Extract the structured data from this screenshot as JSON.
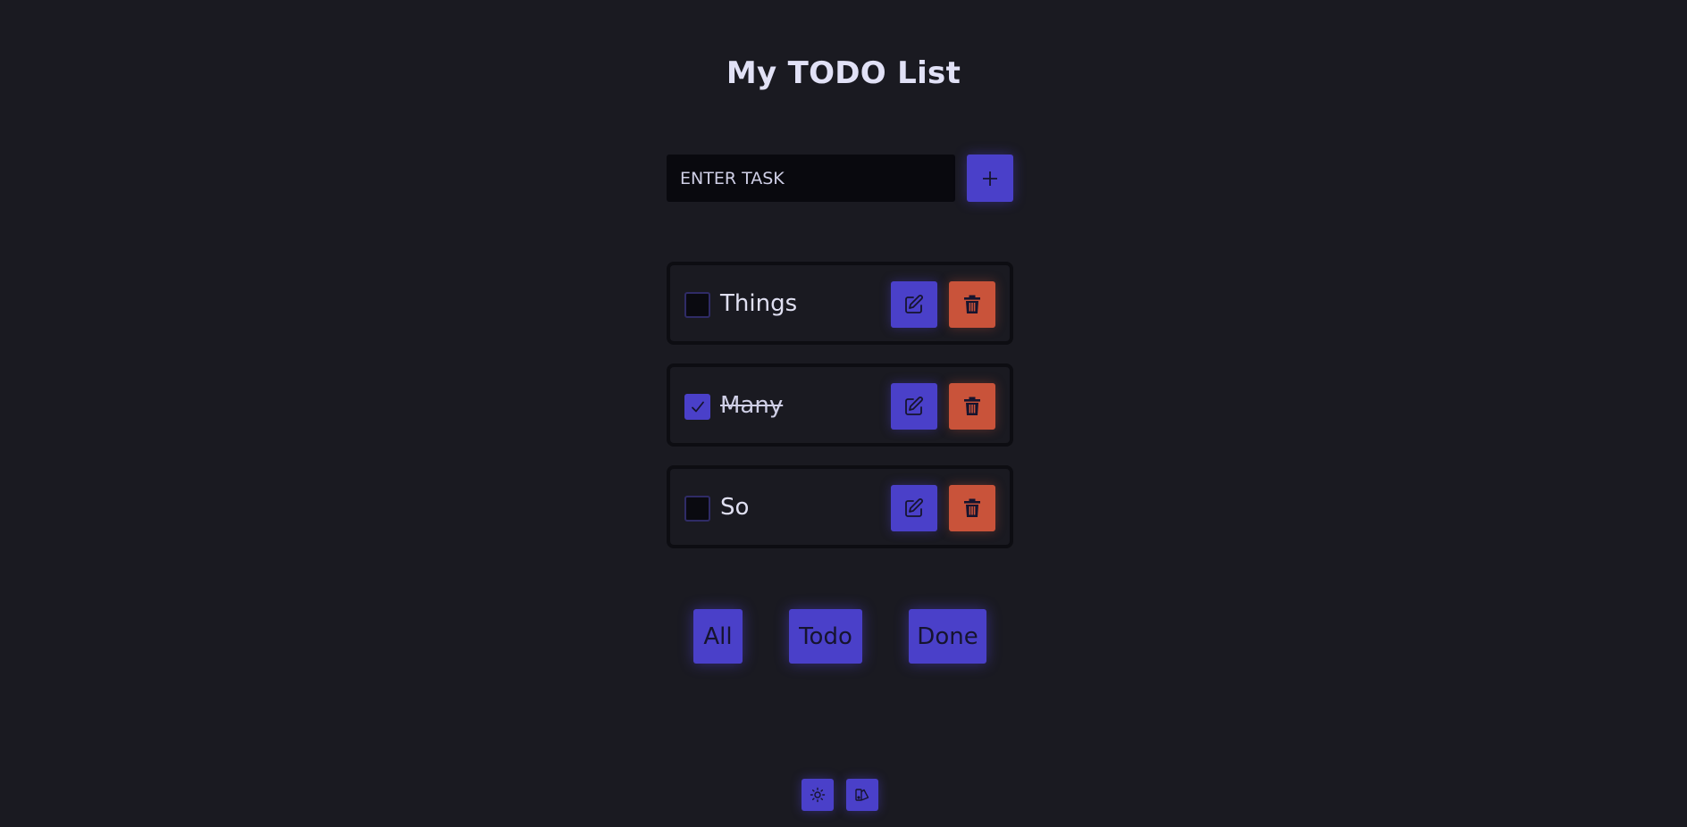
{
  "header": {
    "title": "My TODO List"
  },
  "new_task": {
    "placeholder": "ENTER TASK",
    "value": "",
    "add_icon": "plus-icon"
  },
  "todos": [
    {
      "text": "Things",
      "done": false,
      "edit_icon": "pencil-square-icon",
      "delete_icon": "trash-icon"
    },
    {
      "text": "Many",
      "done": true,
      "edit_icon": "pencil-square-icon",
      "delete_icon": "trash-icon"
    },
    {
      "text": "So",
      "done": false,
      "edit_icon": "pencil-square-icon",
      "delete_icon": "trash-icon"
    }
  ],
  "filters": [
    {
      "label": "All"
    },
    {
      "label": "Todo"
    },
    {
      "label": "Done"
    }
  ],
  "footer": {
    "theme_icon": "sun-icon",
    "palette_icon": "palette-icon"
  },
  "colors": {
    "background": "#1a1a21",
    "accent": "#4a40c9",
    "danger": "#c9533a",
    "input_background": "#09090e",
    "text": "#e1e1f6"
  }
}
